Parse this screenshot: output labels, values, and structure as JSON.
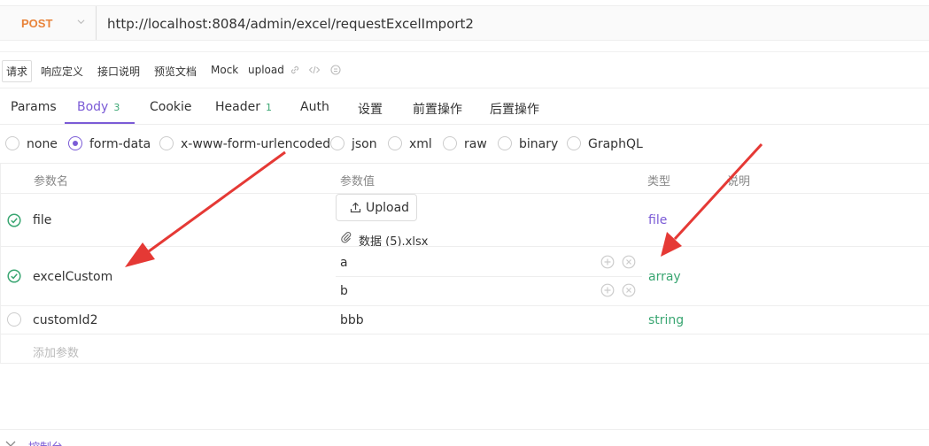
{
  "request": {
    "method": "POST",
    "url": "http://localhost:8084/admin/excel/requestExcelImport2"
  },
  "subtabs": {
    "request": "请求",
    "response_def": "响应定义",
    "api_doc": "接口说明",
    "preview_doc": "预览文档",
    "mock": "Mock",
    "upload": "upload"
  },
  "tabs": {
    "params": "Params",
    "body": "Body",
    "body_count": "3",
    "cookie": "Cookie",
    "header": "Header",
    "header_count": "1",
    "auth": "Auth",
    "settings": "设置",
    "pre_ops": "前置操作",
    "post_ops": "后置操作"
  },
  "body_types": [
    "none",
    "form-data",
    "x-www-form-urlencoded",
    "json",
    "xml",
    "raw",
    "binary",
    "GraphQL"
  ],
  "selected_body_type": "form-data",
  "table": {
    "headers": {
      "name": "参数名",
      "value": "参数值",
      "type": "类型",
      "desc": "说明"
    },
    "rows": [
      {
        "checked": true,
        "name": "file",
        "upload_label": "Upload",
        "file_name": "数据 (5).xlsx",
        "type": "file"
      },
      {
        "checked": true,
        "name": "excelCustom",
        "values": [
          "a",
          "b"
        ],
        "type": "array"
      },
      {
        "checked": false,
        "name": "customId2",
        "value": "bbb",
        "type": "string"
      }
    ],
    "add_param": "添加参数"
  },
  "console": {
    "label": "控制台"
  },
  "colors": {
    "accent": "#7b5bd6",
    "method": "#e8833a",
    "green": "#3aa672",
    "arrow": "#e53935"
  }
}
